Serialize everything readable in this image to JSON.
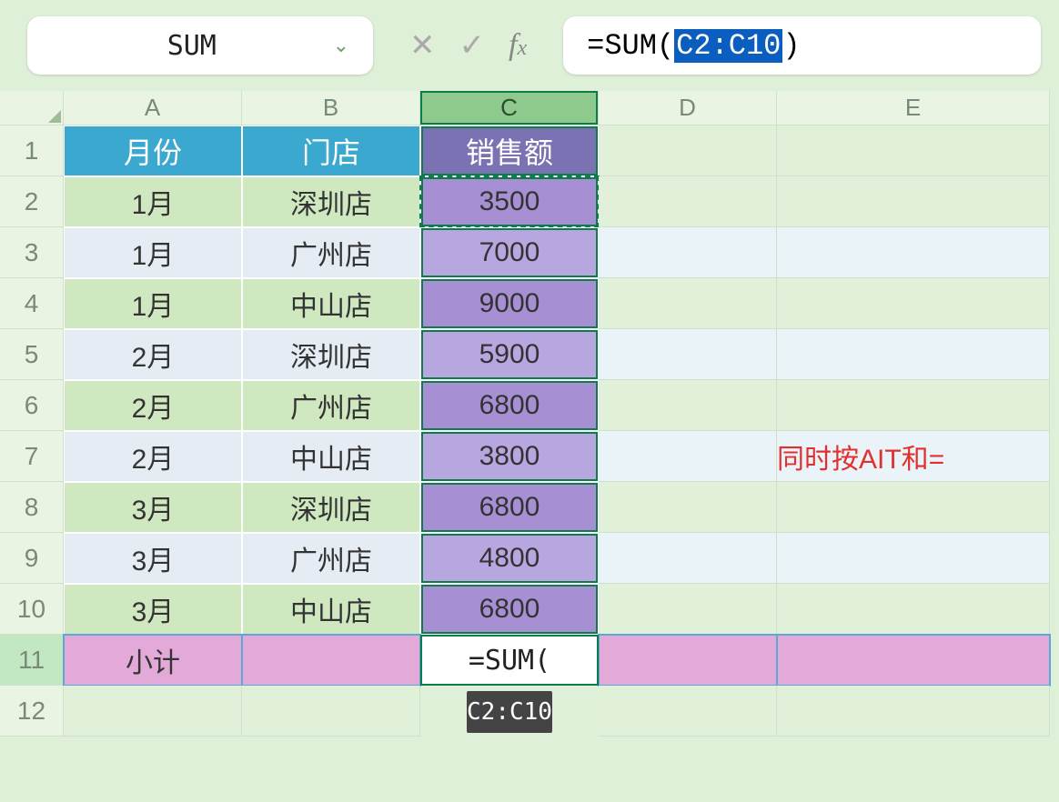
{
  "namebox": {
    "value": "SUM"
  },
  "formula_bar": {
    "prefix": "=SUM(",
    "highlighted": "C2:C10",
    "suffix": ")"
  },
  "columns": [
    "A",
    "B",
    "C",
    "D",
    "E"
  ],
  "row_numbers": [
    "1",
    "2",
    "3",
    "4",
    "5",
    "6",
    "7",
    "8",
    "9",
    "10",
    "11",
    "12"
  ],
  "active_column": "C",
  "active_row": "11",
  "headers": {
    "a": "月份",
    "b": "门店",
    "c": "销售额"
  },
  "rows": [
    {
      "a": "1月",
      "b": "深圳店",
      "c": "3500"
    },
    {
      "a": "1月",
      "b": "广州店",
      "c": "7000"
    },
    {
      "a": "1月",
      "b": "中山店",
      "c": "9000"
    },
    {
      "a": "2月",
      "b": "深圳店",
      "c": "5900"
    },
    {
      "a": "2月",
      "b": "广州店",
      "c": "6800"
    },
    {
      "a": "2月",
      "b": "中山店",
      "c": "3800"
    },
    {
      "a": "3月",
      "b": "深圳店",
      "c": "6800"
    },
    {
      "a": "3月",
      "b": "广州店",
      "c": "4800"
    },
    {
      "a": "3月",
      "b": "中山店",
      "c": "6800"
    }
  ],
  "subtotal": {
    "label": "小计",
    "cell_formula": "=SUM("
  },
  "tooltip": "C2:C10",
  "annotation": "同时按AIT和=",
  "colors": {
    "header_blue": "#3aa8cf",
    "header_purple": "#7a72b3",
    "data_purple": "#a78fd4",
    "subtotal_pink": "#e3a9d9",
    "selection_green": "#0a7d4a",
    "formula_highlight": "#0a5ec0",
    "annotation_red": "#e03030"
  }
}
